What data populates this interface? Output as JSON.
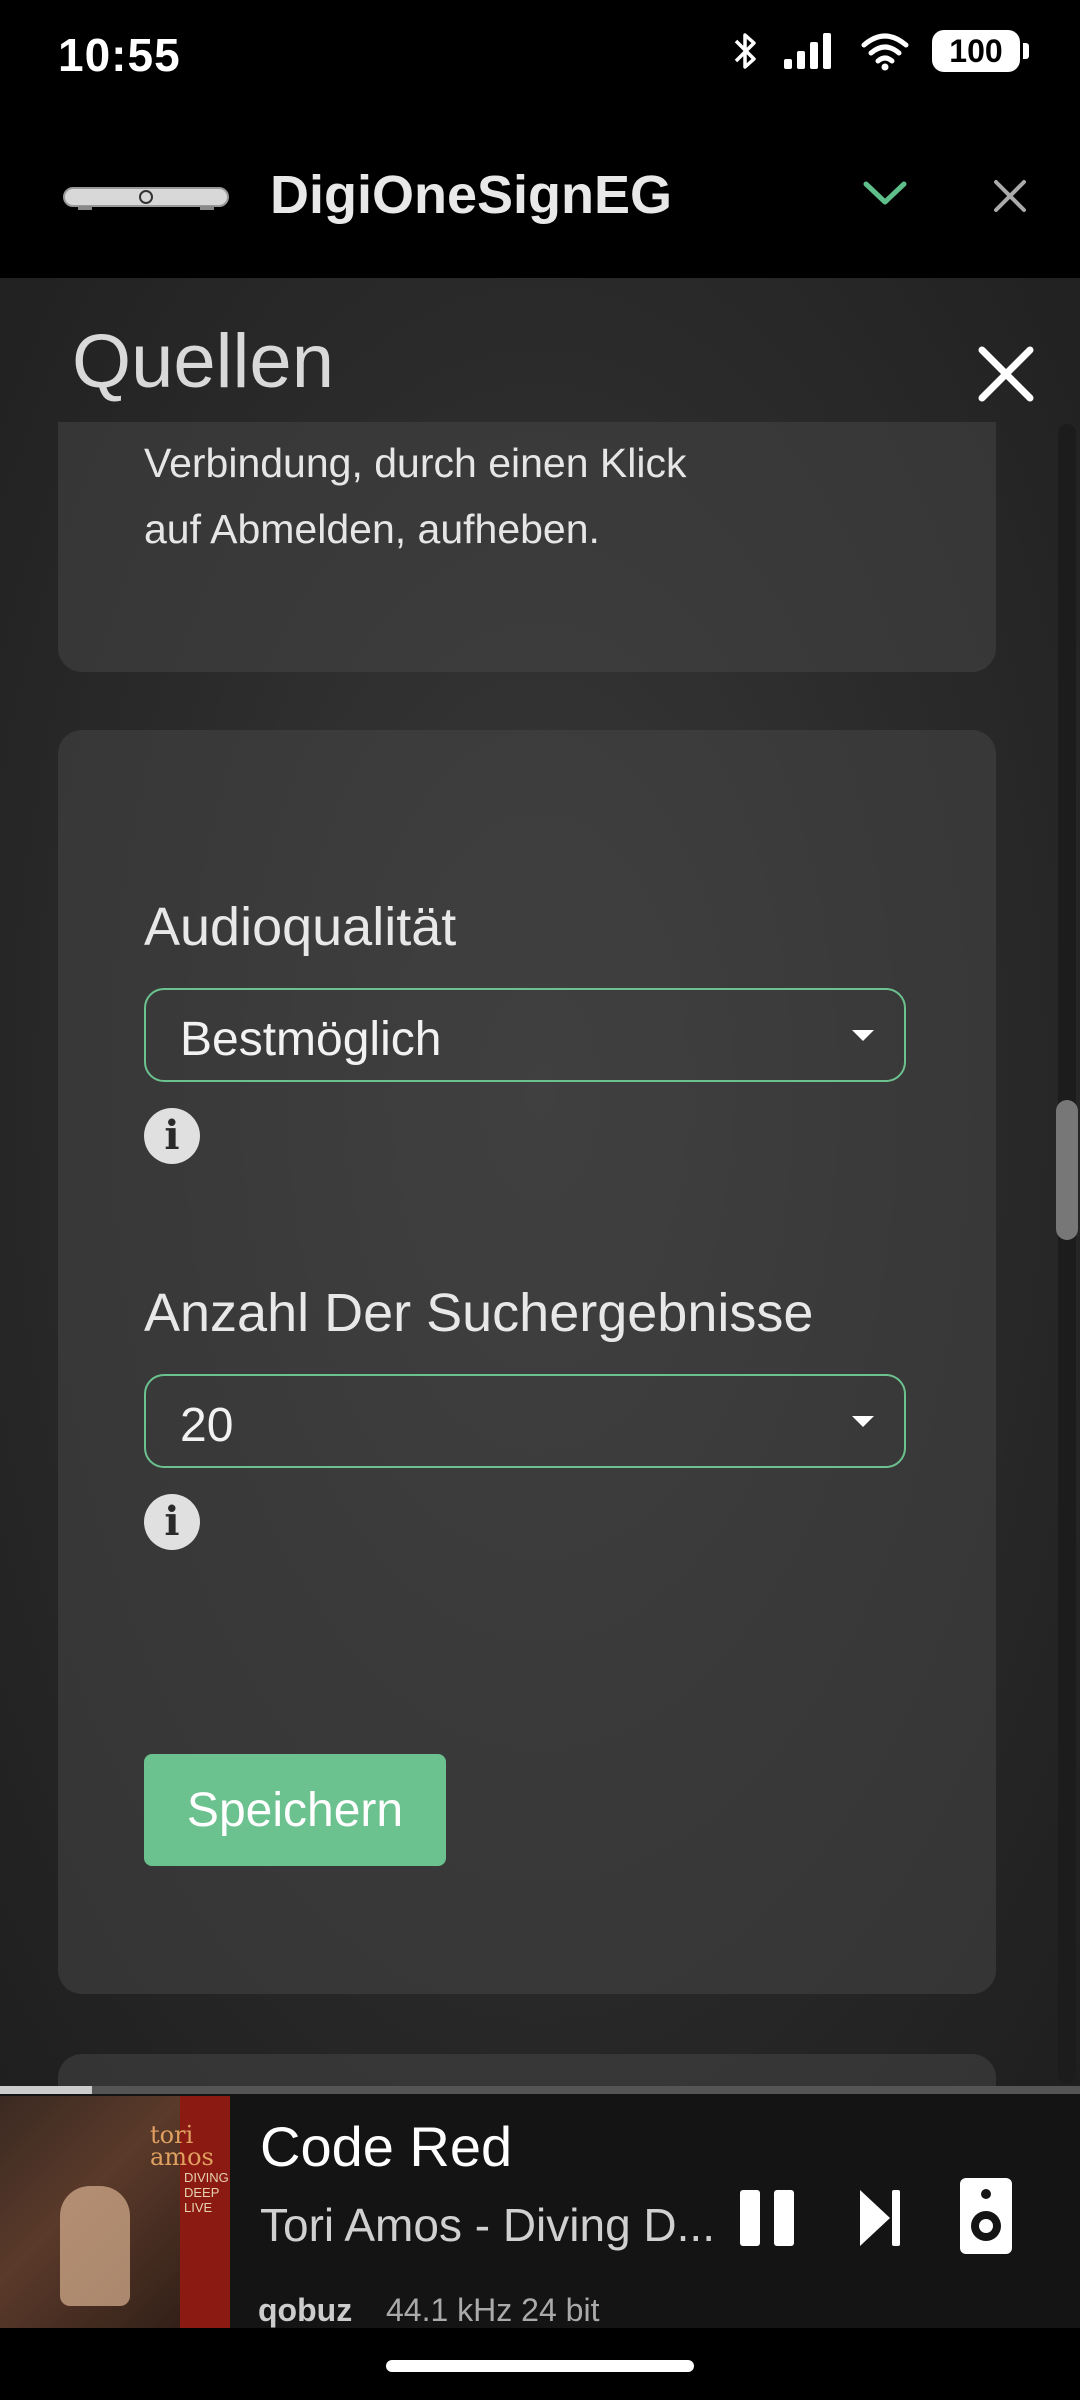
{
  "status": {
    "time": "10:55",
    "battery": "100"
  },
  "header": {
    "device_name": "DigiOneSignEG"
  },
  "panel": {
    "title": "Quellen",
    "disconnect_text_line1": "Verbindung, durch einen Klick",
    "disconnect_text_line2": "auf Abmelden, aufheben.",
    "audio_quality_label": "Audioqualität",
    "audio_quality_value": "Bestmöglich",
    "search_results_label": "Anzahl Der Suchergebnisse",
    "search_results_value": "20",
    "save_label": "Speichern"
  },
  "player": {
    "title": "Code Red",
    "artist": "Tori Amos - Diving D...",
    "service": "qobuz",
    "quality": "44.1 kHz 24 bit",
    "progress_fraction": 0.085,
    "album_art_text": "tori amos",
    "album_art_subtext": "DIVING DEEP LIVE"
  },
  "colors": {
    "accent": "#6cc28f",
    "panel_bg": "#2a2a2a"
  }
}
